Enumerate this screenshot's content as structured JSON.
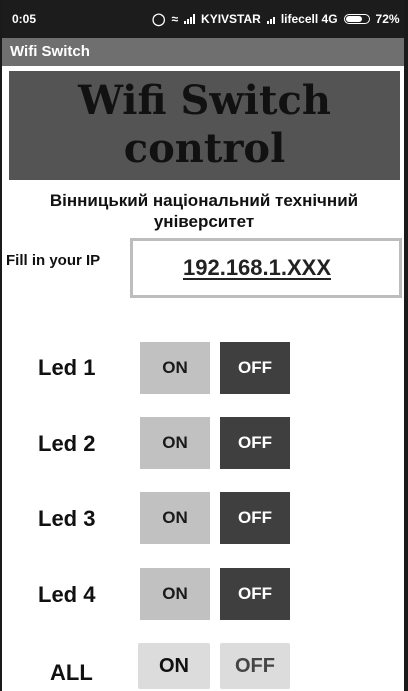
{
  "status_bar": {
    "time": "0:05",
    "carrier1": "KYIVSTAR",
    "carrier2": "lifecell 4G",
    "battery": "72%"
  },
  "app": {
    "title": "Wifi Switch",
    "banner_line1": "Wifi Switch",
    "banner_line2": "control",
    "university": "Вінницький національний технічний університет"
  },
  "ip": {
    "label": "Fill in your IP",
    "value": "192.168.1.XXX"
  },
  "leds": [
    {
      "label": "Led 1",
      "on": "ON",
      "off": "OFF"
    },
    {
      "label": "Led 2",
      "on": "ON",
      "off": "OFF"
    },
    {
      "label": "Led 3",
      "on": "ON",
      "off": "OFF"
    },
    {
      "label": "Led 4",
      "on": "ON",
      "off": "OFF"
    }
  ],
  "all": {
    "label": "ALL",
    "on": "ON",
    "off": "OFF"
  },
  "colors": {
    "status_bar": "#1c1c1c",
    "action_bar": "#6f6f6f",
    "banner": "#545454",
    "on_button": "#c1c1c1",
    "off_button": "#3f3f3f"
  }
}
